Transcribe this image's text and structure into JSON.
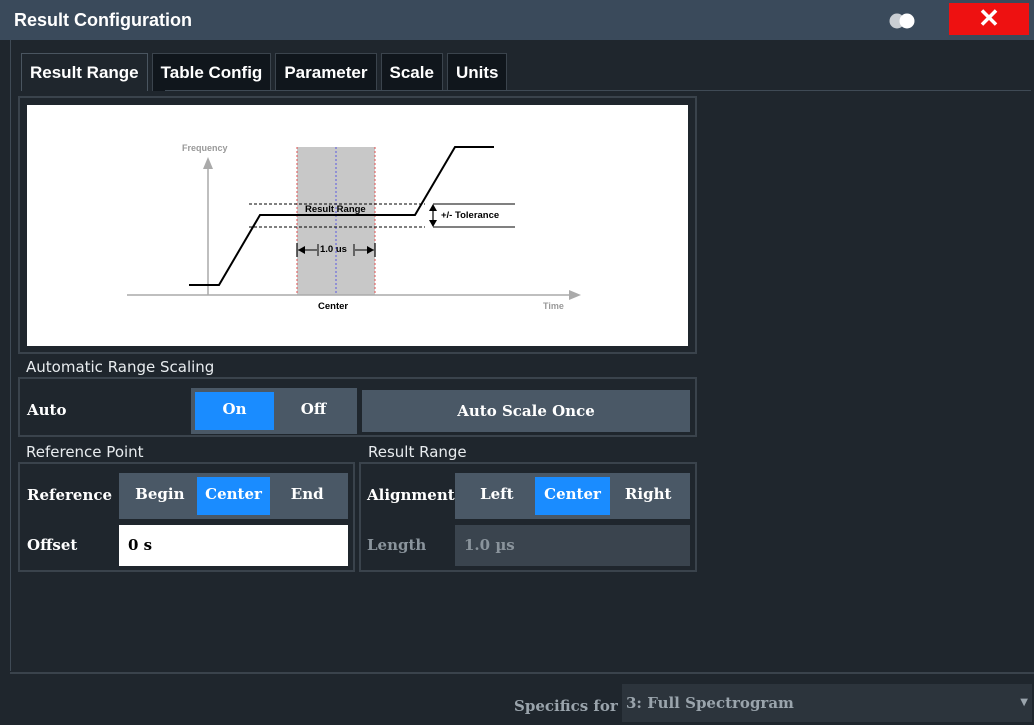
{
  "window": {
    "title": "Result Configuration"
  },
  "tabs": [
    {
      "label": "Result Range",
      "active": true
    },
    {
      "label": "Table Config",
      "active": false
    },
    {
      "label": "Parameter",
      "active": false
    },
    {
      "label": "Scale",
      "active": false
    },
    {
      "label": "Units",
      "active": false
    }
  ],
  "diagram": {
    "frequency_label": "Frequency",
    "time_label": "Time",
    "result_range_label": "Result Range",
    "tolerance_label": "+/- Tolerance",
    "length_label": "1.0 us",
    "center_label": "Center"
  },
  "auto_scaling": {
    "section_label": "Automatic Range Scaling",
    "auto_label": "Auto",
    "on_label": "On",
    "off_label": "Off",
    "selected": "On",
    "auto_scale_once_label": "Auto Scale Once"
  },
  "reference_point": {
    "section_label": "Reference Point",
    "reference_label": "Reference",
    "options": [
      "Begin",
      "Center",
      "End"
    ],
    "selected": "Center",
    "offset_label": "Offset",
    "offset_value": "0 s"
  },
  "result_range": {
    "section_label": "Result Range",
    "alignment_label": "Alignment",
    "options": [
      "Left",
      "Center",
      "Right"
    ],
    "selected": "Center",
    "length_label": "Length",
    "length_value": "1.0 µs"
  },
  "footer": {
    "specifics_label": "Specifics for",
    "specifics_value": "3: Full Spectrogram"
  },
  "colors": {
    "accent": "#1a8cff",
    "close": "#ee1111",
    "background": "#1f262d",
    "titlebar": "#3a4a5b"
  }
}
